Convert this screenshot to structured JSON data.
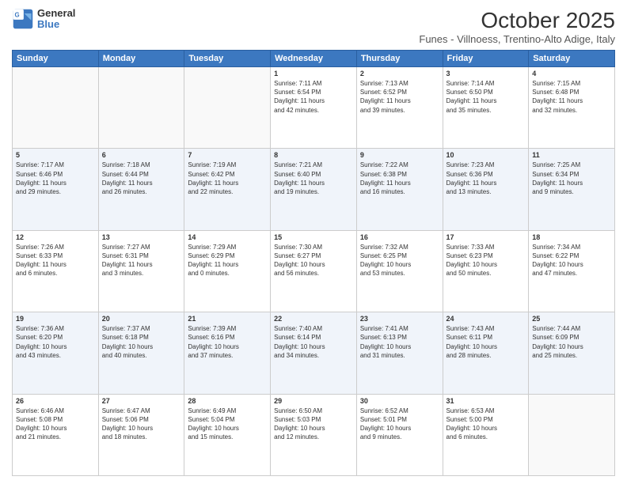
{
  "header": {
    "logo_line1": "General",
    "logo_line2": "Blue",
    "title": "October 2025",
    "subtitle": "Funes - Villnoess, Trentino-Alto Adige, Italy"
  },
  "days_of_week": [
    "Sunday",
    "Monday",
    "Tuesday",
    "Wednesday",
    "Thursday",
    "Friday",
    "Saturday"
  ],
  "weeks": [
    [
      {
        "day": "",
        "info": ""
      },
      {
        "day": "",
        "info": ""
      },
      {
        "day": "",
        "info": ""
      },
      {
        "day": "1",
        "info": "Sunrise: 7:11 AM\nSunset: 6:54 PM\nDaylight: 11 hours\nand 42 minutes."
      },
      {
        "day": "2",
        "info": "Sunrise: 7:13 AM\nSunset: 6:52 PM\nDaylight: 11 hours\nand 39 minutes."
      },
      {
        "day": "3",
        "info": "Sunrise: 7:14 AM\nSunset: 6:50 PM\nDaylight: 11 hours\nand 35 minutes."
      },
      {
        "day": "4",
        "info": "Sunrise: 7:15 AM\nSunset: 6:48 PM\nDaylight: 11 hours\nand 32 minutes."
      }
    ],
    [
      {
        "day": "5",
        "info": "Sunrise: 7:17 AM\nSunset: 6:46 PM\nDaylight: 11 hours\nand 29 minutes."
      },
      {
        "day": "6",
        "info": "Sunrise: 7:18 AM\nSunset: 6:44 PM\nDaylight: 11 hours\nand 26 minutes."
      },
      {
        "day": "7",
        "info": "Sunrise: 7:19 AM\nSunset: 6:42 PM\nDaylight: 11 hours\nand 22 minutes."
      },
      {
        "day": "8",
        "info": "Sunrise: 7:21 AM\nSunset: 6:40 PM\nDaylight: 11 hours\nand 19 minutes."
      },
      {
        "day": "9",
        "info": "Sunrise: 7:22 AM\nSunset: 6:38 PM\nDaylight: 11 hours\nand 16 minutes."
      },
      {
        "day": "10",
        "info": "Sunrise: 7:23 AM\nSunset: 6:36 PM\nDaylight: 11 hours\nand 13 minutes."
      },
      {
        "day": "11",
        "info": "Sunrise: 7:25 AM\nSunset: 6:34 PM\nDaylight: 11 hours\nand 9 minutes."
      }
    ],
    [
      {
        "day": "12",
        "info": "Sunrise: 7:26 AM\nSunset: 6:33 PM\nDaylight: 11 hours\nand 6 minutes."
      },
      {
        "day": "13",
        "info": "Sunrise: 7:27 AM\nSunset: 6:31 PM\nDaylight: 11 hours\nand 3 minutes."
      },
      {
        "day": "14",
        "info": "Sunrise: 7:29 AM\nSunset: 6:29 PM\nDaylight: 11 hours\nand 0 minutes."
      },
      {
        "day": "15",
        "info": "Sunrise: 7:30 AM\nSunset: 6:27 PM\nDaylight: 10 hours\nand 56 minutes."
      },
      {
        "day": "16",
        "info": "Sunrise: 7:32 AM\nSunset: 6:25 PM\nDaylight: 10 hours\nand 53 minutes."
      },
      {
        "day": "17",
        "info": "Sunrise: 7:33 AM\nSunset: 6:23 PM\nDaylight: 10 hours\nand 50 minutes."
      },
      {
        "day": "18",
        "info": "Sunrise: 7:34 AM\nSunset: 6:22 PM\nDaylight: 10 hours\nand 47 minutes."
      }
    ],
    [
      {
        "day": "19",
        "info": "Sunrise: 7:36 AM\nSunset: 6:20 PM\nDaylight: 10 hours\nand 43 minutes."
      },
      {
        "day": "20",
        "info": "Sunrise: 7:37 AM\nSunset: 6:18 PM\nDaylight: 10 hours\nand 40 minutes."
      },
      {
        "day": "21",
        "info": "Sunrise: 7:39 AM\nSunset: 6:16 PM\nDaylight: 10 hours\nand 37 minutes."
      },
      {
        "day": "22",
        "info": "Sunrise: 7:40 AM\nSunset: 6:14 PM\nDaylight: 10 hours\nand 34 minutes."
      },
      {
        "day": "23",
        "info": "Sunrise: 7:41 AM\nSunset: 6:13 PM\nDaylight: 10 hours\nand 31 minutes."
      },
      {
        "day": "24",
        "info": "Sunrise: 7:43 AM\nSunset: 6:11 PM\nDaylight: 10 hours\nand 28 minutes."
      },
      {
        "day": "25",
        "info": "Sunrise: 7:44 AM\nSunset: 6:09 PM\nDaylight: 10 hours\nand 25 minutes."
      }
    ],
    [
      {
        "day": "26",
        "info": "Sunrise: 6:46 AM\nSunset: 5:08 PM\nDaylight: 10 hours\nand 21 minutes."
      },
      {
        "day": "27",
        "info": "Sunrise: 6:47 AM\nSunset: 5:06 PM\nDaylight: 10 hours\nand 18 minutes."
      },
      {
        "day": "28",
        "info": "Sunrise: 6:49 AM\nSunset: 5:04 PM\nDaylight: 10 hours\nand 15 minutes."
      },
      {
        "day": "29",
        "info": "Sunrise: 6:50 AM\nSunset: 5:03 PM\nDaylight: 10 hours\nand 12 minutes."
      },
      {
        "day": "30",
        "info": "Sunrise: 6:52 AM\nSunset: 5:01 PM\nDaylight: 10 hours\nand 9 minutes."
      },
      {
        "day": "31",
        "info": "Sunrise: 6:53 AM\nSunset: 5:00 PM\nDaylight: 10 hours\nand 6 minutes."
      },
      {
        "day": "",
        "info": ""
      }
    ]
  ]
}
